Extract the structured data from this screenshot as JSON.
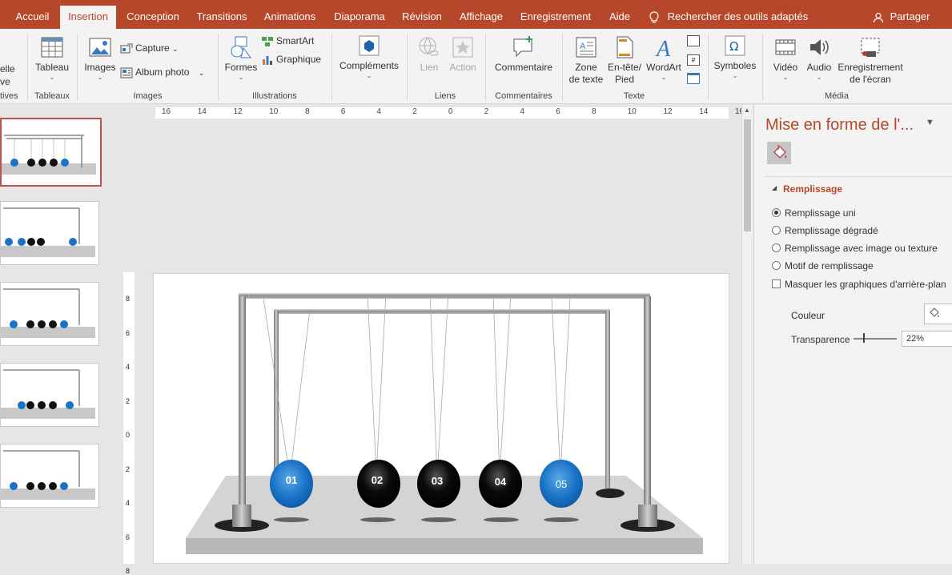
{
  "tabs": [
    {
      "label": "Accueil",
      "active": false
    },
    {
      "label": "Insertion",
      "active": true
    },
    {
      "label": "Conception",
      "active": false
    },
    {
      "label": "Transitions",
      "active": false
    },
    {
      "label": "Animations",
      "active": false
    },
    {
      "label": "Diaporama",
      "active": false
    },
    {
      "label": "Révision",
      "active": false
    },
    {
      "label": "Affichage",
      "active": false
    },
    {
      "label": "Enregistrement",
      "active": false
    },
    {
      "label": "Aide",
      "active": false
    }
  ],
  "search_tools": "Rechercher des outils adaptés",
  "share": "Partager",
  "ribbon": {
    "cut_left_top": "elle",
    "cut_left_bottom": "ve",
    "cut_group": "tives",
    "tableau": "Tableau",
    "tableaux_group": "Tableaux",
    "images": "Images",
    "capture": "Capture",
    "album": "Album photo",
    "images_group": "Images",
    "formes": "Formes",
    "smartart": "SmartArt",
    "graphique": "Graphique",
    "illustrations_group": "Illustrations",
    "complements": "Compléments",
    "lien": "Lien",
    "action": "Action",
    "liens_group": "Liens",
    "commentaire": "Commentaire",
    "commentaires_group": "Commentaires",
    "zone_texte_1": "Zone",
    "zone_texte_2": "de texte",
    "entete_1": "En-tête/",
    "entete_2": "Pied",
    "wordart": "WordArt",
    "texte_group": "Texte",
    "symboles": "Symboles",
    "video": "Vidéo",
    "audio": "Audio",
    "enreg_1": "Enregistrement",
    "enreg_2": "de l'écran",
    "media_group": "Média"
  },
  "ruler_h": [
    "16",
    "14",
    "12",
    "10",
    "8",
    "6",
    "4",
    "2",
    "0",
    "2",
    "4",
    "6",
    "8",
    "10",
    "12",
    "14",
    "16"
  ],
  "ruler_v": [
    "8",
    "6",
    "4",
    "2",
    "0",
    "2",
    "4",
    "6",
    "8"
  ],
  "slide": {
    "balls": [
      {
        "label": "01",
        "color": "#1a73c6"
      },
      {
        "label": "02",
        "color": "#000000"
      },
      {
        "label": "03",
        "color": "#000000"
      },
      {
        "label": "04",
        "color": "#000000"
      },
      {
        "label": "05",
        "color": "#1a73c6"
      }
    ]
  },
  "pane": {
    "title": "Mise en forme de l'...",
    "section": "Remplissage",
    "options": [
      {
        "label": "Remplissage uni",
        "checked": true
      },
      {
        "label": "Remplissage dégradé",
        "checked": false
      },
      {
        "label": "Remplissage avec image ou texture",
        "checked": false
      },
      {
        "label": "Motif de remplissage",
        "checked": false
      }
    ],
    "hide_bg": "Masquer les graphiques d'arrière-plan",
    "couleur": "Couleur",
    "transparence": "Transparence",
    "transparence_value": "22%",
    "transparence_level": 0.22
  },
  "colors": {
    "accent": "#b7472a",
    "blue_ball": "#1a73c6"
  }
}
